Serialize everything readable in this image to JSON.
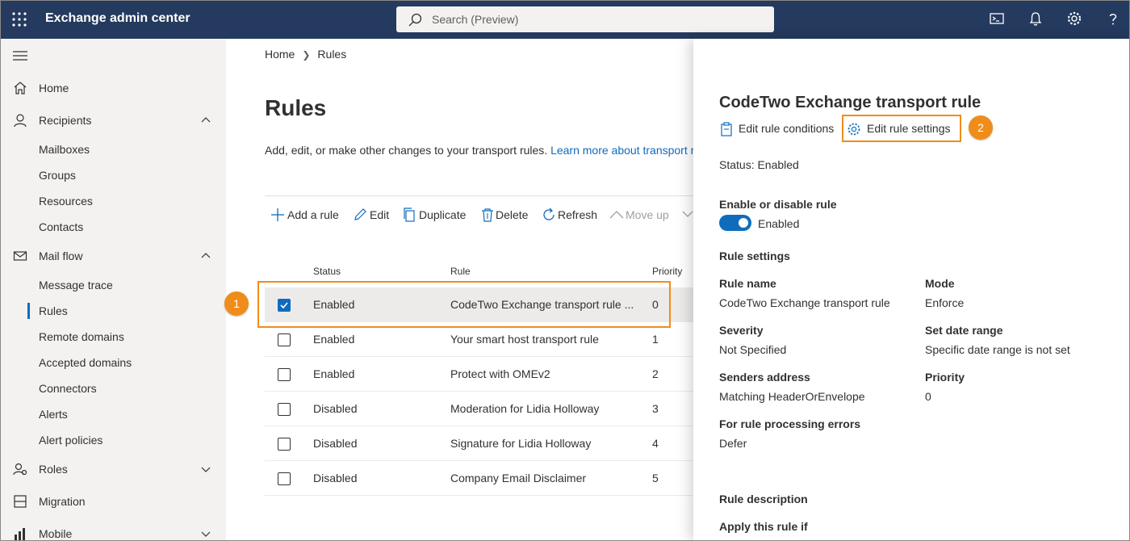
{
  "app": {
    "title": "Exchange admin center"
  },
  "search": {
    "placeholder": "Search (Preview)"
  },
  "topbar_icons": [
    "terminal-icon",
    "bell-icon",
    "gear-icon",
    "help-icon"
  ],
  "nav": {
    "home": "Home",
    "recipients": "Recipients",
    "recipients_sub": [
      "Mailboxes",
      "Groups",
      "Resources",
      "Contacts"
    ],
    "mailflow": "Mail flow",
    "mailflow_sub": [
      "Message trace",
      "Rules",
      "Remote domains",
      "Accepted domains",
      "Connectors",
      "Alerts",
      "Alert policies"
    ],
    "roles": "Roles",
    "migration": "Migration",
    "mobile": "Mobile"
  },
  "breadcrumb": {
    "home": "Home",
    "current": "Rules"
  },
  "page": {
    "title": "Rules",
    "description": "Add, edit, or make other changes to your transport rules.",
    "learn_more": "Learn more about transport r"
  },
  "toolbar": {
    "add": "Add a rule",
    "edit": "Edit",
    "duplicate": "Duplicate",
    "delete": "Delete",
    "refresh": "Refresh",
    "move_up": "Move up"
  },
  "table": {
    "columns": {
      "status": "Status",
      "rule": "Rule",
      "priority": "Priority"
    },
    "rows": [
      {
        "status": "Enabled",
        "rule": "CodeTwo Exchange transport rule ...",
        "priority": "0",
        "selected": true
      },
      {
        "status": "Enabled",
        "rule": "Your smart host transport rule",
        "priority": "1",
        "selected": false
      },
      {
        "status": "Enabled",
        "rule": "Protect with OMEv2",
        "priority": "2",
        "selected": false
      },
      {
        "status": "Disabled",
        "rule": "Moderation for Lidia Holloway",
        "priority": "3",
        "selected": false
      },
      {
        "status": "Disabled",
        "rule": "Signature for Lidia Holloway",
        "priority": "4",
        "selected": false
      },
      {
        "status": "Disabled",
        "rule": "Company Email Disclaimer",
        "priority": "5",
        "selected": false
      }
    ]
  },
  "callouts": {
    "one": "1",
    "two": "2"
  },
  "panel": {
    "title": "CodeTwo Exchange transport rule",
    "edit_conditions": "Edit rule conditions",
    "edit_settings": "Edit rule settings",
    "status": "Status: Enabled",
    "enable_label": "Enable or disable rule",
    "toggle_state": "Enabled",
    "settings_heading": "Rule settings",
    "rule_name_label": "Rule name",
    "rule_name_value": "CodeTwo Exchange transport rule",
    "mode_label": "Mode",
    "mode_value": "Enforce",
    "severity_label": "Severity",
    "severity_value": "Not Specified",
    "date_range_label": "Set date range",
    "date_range_value": "Specific date range is not set",
    "senders_label": "Senders address",
    "senders_value": "Matching HeaderOrEnvelope",
    "priority_label": "Priority",
    "priority_value": "0",
    "errors_label": "For rule processing errors",
    "errors_value": "Defer",
    "description_heading": "Rule description",
    "apply_if": "Apply this rule if"
  },
  "colors": {
    "header_bg": "#243a5e",
    "accent": "#0f6cbd",
    "callout": "#f08c1a",
    "nav_bg": "#f3f2f1"
  }
}
